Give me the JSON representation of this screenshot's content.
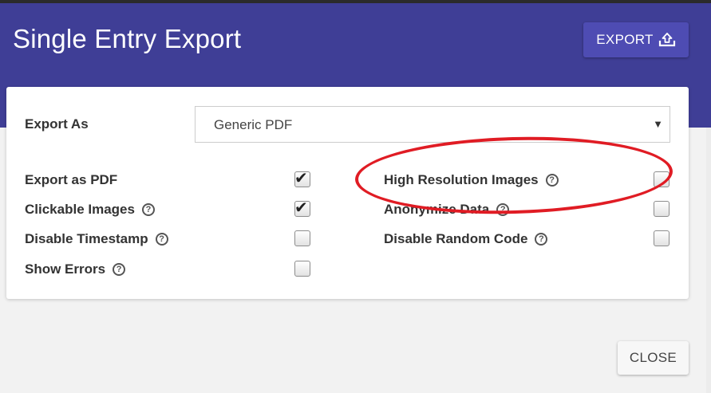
{
  "dialog": {
    "title": "Single Entry Export",
    "export_label": "EXPORT",
    "close_label": "CLOSE"
  },
  "form": {
    "export_as_label": "Export As",
    "export_as_value": "Generic PDF",
    "help_glyph": "?",
    "options": {
      "export_as_pdf": {
        "label": "Export as PDF",
        "checked": true
      },
      "clickable_images": {
        "label": "Clickable Images",
        "checked": true
      },
      "disable_timestamp": {
        "label": "Disable Timestamp",
        "checked": false
      },
      "show_errors": {
        "label": "Show Errors",
        "checked": false
      },
      "high_resolution_images": {
        "label": "High Resolution Images",
        "checked": false
      },
      "anonymize_data": {
        "label": "Anonymize Data",
        "checked": false
      },
      "disable_random_code": {
        "label": "Disable Random Code",
        "checked": false
      }
    }
  },
  "colors": {
    "header": "#3f3e96",
    "export_button": "#4e4cb3",
    "annotation": "#e01c24"
  },
  "icons": {
    "export": "upload-tray-icon",
    "dropdown": "caret-down-icon",
    "help": "help-circle-icon",
    "check": "checkmark-icon"
  }
}
